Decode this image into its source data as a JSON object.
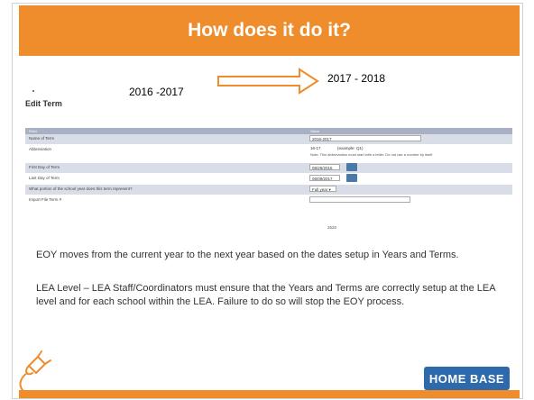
{
  "slide": {
    "title": "How does it do it?",
    "year_from": "2016 -2017",
    "year_to": "2017 - 2018"
  },
  "form": {
    "heading": "Edit Term",
    "columns": [
      "Field",
      "Value"
    ],
    "rows": [
      {
        "label": "Name of Term",
        "value": "2016-2017"
      },
      {
        "label": "Abbreviation",
        "value": "16-17",
        "hint": "(example: Q1)",
        "note": "Note: This abbreviation must start with a letter. Do not use a number by itself"
      },
      {
        "label": "First Day of Term",
        "value": "08/29/2016"
      },
      {
        "label": "Last Day of Term",
        "value": "06/09/2017"
      },
      {
        "label": "What portion of the school year does this term represent?",
        "value": "Full year"
      },
      {
        "label": "Import File Term #",
        "value": ""
      }
    ],
    "save_label": "2620"
  },
  "body": {
    "paragraph1": "EOY moves from the current year to the next year based on the dates setup in Years and Terms.",
    "paragraph2": "LEA Level – LEA Staff/Coordinators must ensure that the Years and Terms are correctly setup at the LEA level and for each school within the LEA. Failure to do so will stop the EOY process."
  },
  "logo": {
    "text": "HOME BASE"
  },
  "colors": {
    "accent": "#ef8c2c",
    "logo_bg": "#2e6aab",
    "grid_header": "#a8b1c3",
    "grid_odd": "#d8dde8"
  }
}
